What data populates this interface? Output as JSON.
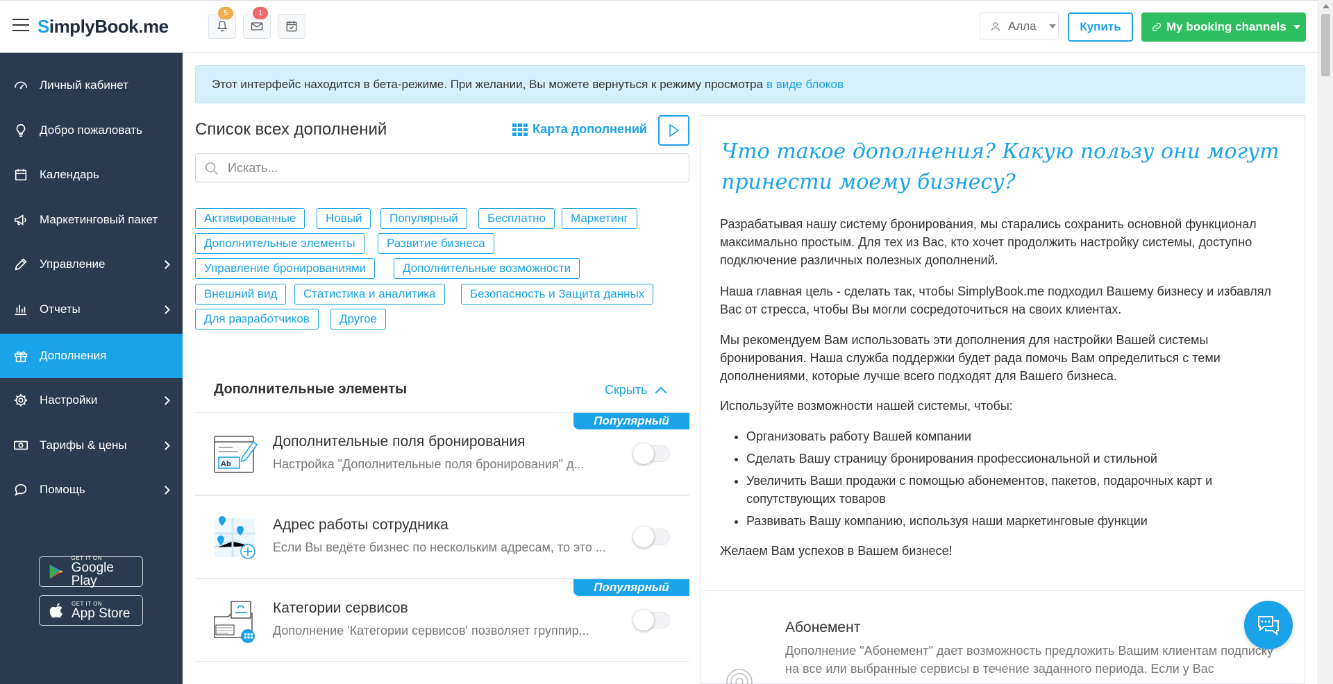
{
  "header": {
    "logo_s": "S",
    "logo_rest": "implyBook",
    "logo_tld": ".me",
    "notifications_badge": "5",
    "messages_badge": "1",
    "user_name": "Алла",
    "buy_label": "Купить",
    "channels_label": "My booking channels",
    "badge_colors": {
      "notifications": "#f0ad4e",
      "messages": "#ef6b6b"
    }
  },
  "sidebar": {
    "items": [
      {
        "label": "Личный кабинет",
        "icon": "dashboard-icon"
      },
      {
        "label": "Добро пожаловать",
        "icon": "lightbulb-icon"
      },
      {
        "label": "Календарь",
        "icon": "calendar-icon"
      },
      {
        "label": "Маркетинговый пакет",
        "icon": "megaphone-icon"
      },
      {
        "label": "Управление",
        "icon": "pencil-icon"
      },
      {
        "label": "Отчеты",
        "icon": "bar-chart-icon"
      },
      {
        "label": "Дополнения",
        "icon": "gift-icon"
      },
      {
        "label": "Настройки",
        "icon": "gear-icon"
      },
      {
        "label": "Тарифы & цены",
        "icon": "money-icon"
      },
      {
        "label": "Помощь",
        "icon": "chat-bubble-icon"
      }
    ],
    "google_play": {
      "small": "GET IT ON",
      "big": "Google Play"
    },
    "app_store": {
      "small": "GET IT ON",
      "big": "App Store"
    }
  },
  "beta_banner": {
    "text": "Этот интерфейс находится в бета-режиме. При желании, Вы можете вернуться к режиму просмотра",
    "link": "в виде блоков"
  },
  "addons": {
    "title": "Список всех дополнений",
    "map_link": "Карта дополнений",
    "search_placeholder": "Искать...",
    "tags": [
      "Активированные",
      "Новый",
      "Популярный",
      "Бесплатно",
      "Маркетинг",
      "Дополнительные элементы",
      "Развитие бизнеса",
      "Управление бронированиями",
      "Дополнительные возможности",
      "Внешний вид",
      "Статистика и аналитика",
      "Безопасность и Защита данных",
      "Для разработчиков",
      "Другое"
    ],
    "section_title": "Дополнительные элементы",
    "hide_label": "Скрыть",
    "cards": [
      {
        "title": "Дополнительные поля бронирования",
        "desc": "Настройка \"Дополнительные поля бронирования\" д...",
        "badge": "Популярный",
        "icon": "form-fields-icon"
      },
      {
        "title": "Адрес работы сотрудника",
        "desc": "Если Вы ведёте бизнес по нескольким адресам, то это ...",
        "badge": "",
        "icon": "map-pins-icon"
      },
      {
        "title": "Категории сервисов",
        "desc": "Дополнение 'Категории сервисов' позволяет группир...",
        "badge": "Популярный",
        "icon": "categories-icon"
      }
    ]
  },
  "info": {
    "question": "Что такое дополнения? Какую пользу они могут принести моему бизнесу?",
    "p1": "Разрабатывая нашу систему бронирования, мы старались сохранить основной функционал максимально простым. Для тех из Вас, кто хочет продолжить настройку системы, доступно подключение различных полезных дополнений.",
    "p2": "Наша главная цель - сделать так, чтобы SimplyBook.me подходил Вашему бизнесу и избавлял Вас от стресса, чтобы Вы могли сосредоточиться на своих клиентах.",
    "p3": "Мы рекомендуем Вам использовать эти дополнения для настройки Вашей системы бронирования. Наша служба поддержки будет рада помочь Вам определиться с теми дополнениями, которые лучше всего подходят для Вашего бизнеса.",
    "p4": "Используйте возможности нашей системы, чтобы:",
    "bullets": [
      "Организовать работу Вашей компании",
      "Сделать Вашу страницу бронирования профессиональной и стильной",
      "Увеличить Ваши продажи с помощью абонементов, пакетов, подарочных карт и сопутствующих товаров",
      "Развивать Вашу компанию, используя наши маркетинговые функции"
    ],
    "p5": "Желаем Вам успехов в Вашем бизнесе!",
    "sub_title": "Абонемент",
    "sub_desc": "Дополнение \"Абонемент\" дает возможность предложить Вашим клиентам подписку на все или выбранные сервисы в течение заданного периода. Если у Вас"
  },
  "colors": {
    "accent": "#1aa3e8",
    "green": "#2dbe60",
    "sidebar": "#2b3a4f"
  }
}
